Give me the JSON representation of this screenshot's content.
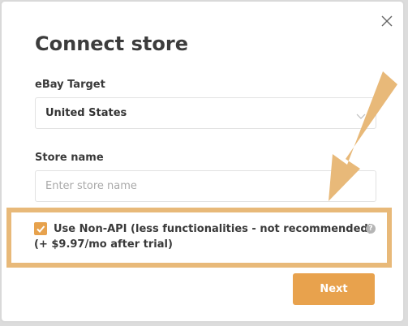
{
  "modal": {
    "title": "Connect store",
    "close_icon": "close-icon"
  },
  "ebay_target": {
    "label": "eBay Target",
    "selected": "United States",
    "chevron_icon": "chevron-down-icon"
  },
  "store_name": {
    "label": "Store name",
    "value": "",
    "placeholder": "Enter store name"
  },
  "non_api_option": {
    "checked": true,
    "label_line1": "Use Non-API (less functionalities - not recommended)",
    "label_line2": "(+ $9.97/mo after trial)",
    "help_icon": "question-icon"
  },
  "next_button": {
    "label": "Next"
  },
  "colors": {
    "accent": "#e8a24d",
    "annotation": "#e8b979"
  }
}
